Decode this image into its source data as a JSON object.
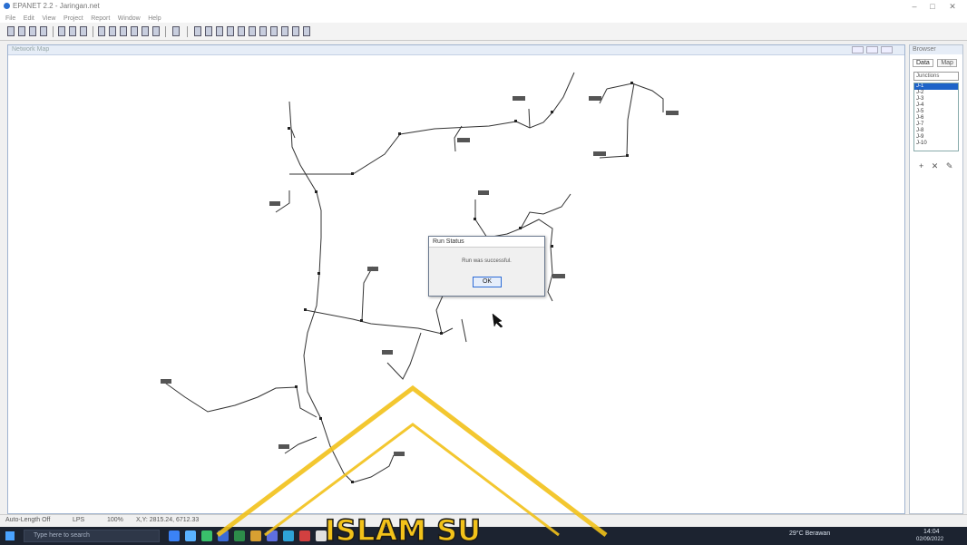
{
  "window": {
    "title": "EPANET 2.2 - Jaringan.net",
    "controls": [
      "–",
      "□",
      "✕"
    ]
  },
  "menu": [
    "File",
    "Edit",
    "View",
    "Project",
    "Report",
    "Window",
    "Help"
  ],
  "map_window": {
    "title": "Network Map",
    "buttons": [
      "",
      "",
      ""
    ]
  },
  "browser": {
    "title": "Browser",
    "tabs": [
      "Data",
      "Map"
    ],
    "dropdown": "Junctions",
    "items": [
      "J-1",
      "J-2",
      "J-3",
      "J-4",
      "J-5",
      "J-6",
      "J-7",
      "J-8",
      "J-9",
      "J-10"
    ],
    "selected_index": 0
  },
  "dialog": {
    "title": "Run Status",
    "message": "Run was successful.",
    "ok_label": "OK"
  },
  "statusbar": {
    "autolength": "Auto-Length Off",
    "units": "LPS",
    "zoom": "100%",
    "coords": "X,Y: 2815.24, 6712.33"
  },
  "taskbar": {
    "search_placeholder": "Type here to search",
    "weather": "29°C Berawan",
    "time": "14:04",
    "date": "02/09/2022"
  },
  "watermark": {
    "text": "ISLAM SU",
    "color": "#f2c21a"
  }
}
